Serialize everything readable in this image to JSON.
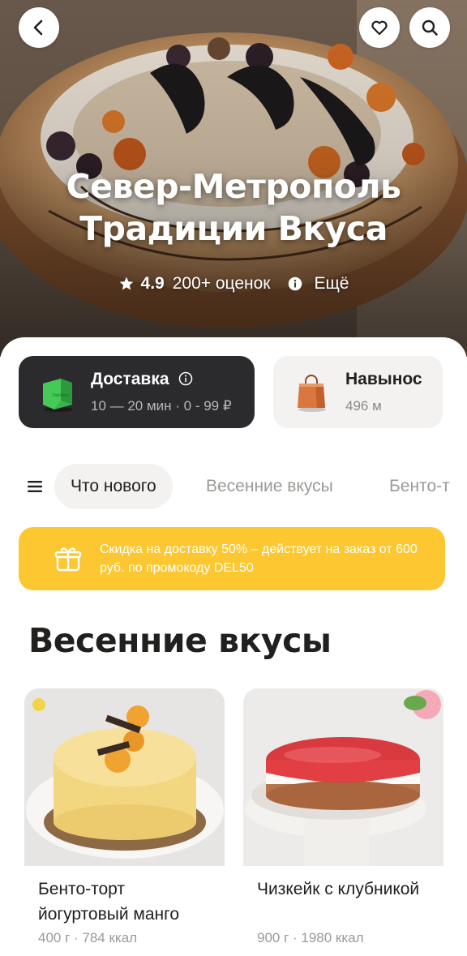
{
  "header": {
    "title_line1": "Север-Метрополь",
    "title_line2": "Традиции Вкуса",
    "rating": "4.9",
    "reviews": "200+ оценок",
    "more": "Ещё"
  },
  "modes": {
    "delivery": {
      "title": "Доставка",
      "subtitle": "10 — 20 мин · 0 - 99 ₽",
      "selected": true
    },
    "pickup": {
      "title": "Навынос",
      "subtitle": "496 м",
      "selected": false
    }
  },
  "categories": [
    {
      "label": "Что нового",
      "active": true
    },
    {
      "label": "Весенние вкусы",
      "active": false
    },
    {
      "label": "Бенто-т",
      "active": false
    }
  ],
  "promo": {
    "text": "Скидка на доставку 50% – действует на заказ от 600 руб. по промокоду DEL50"
  },
  "section": {
    "title": "Весенние вкусы"
  },
  "products": [
    {
      "name": "Бенто-торт йогуртовый манго",
      "meta": "400 г · 784 ккал"
    },
    {
      "name": "Чизкейк с клубникой",
      "meta": "900 г · 1980 ккал"
    }
  ],
  "colors": {
    "promo": "#fcc730",
    "delivery_card": "#2b2b2e",
    "tab_active_bg": "#f3f2f0"
  }
}
